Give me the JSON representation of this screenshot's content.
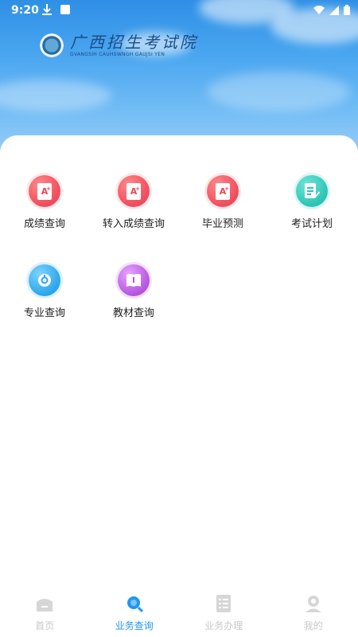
{
  "status_bar": {
    "time": "9:20"
  },
  "brand": {
    "name": "广西招生考试院",
    "subtitle": "GVANGSIH CAUHSWNGH GAUJSI YEN"
  },
  "menu": [
    {
      "label": "成绩查询",
      "icon": "score-report-icon",
      "color": "#ef4b5c"
    },
    {
      "label": "转入成绩查询",
      "icon": "transfer-score-icon",
      "color": "#ef4b5c"
    },
    {
      "label": "毕业预测",
      "icon": "graduation-forecast-icon",
      "color": "#ef4b5c"
    },
    {
      "label": "考试计划",
      "icon": "exam-plan-icon",
      "color": "#2bc4b4"
    },
    {
      "label": "专业查询",
      "icon": "major-query-icon",
      "color": "#2aa6ea"
    },
    {
      "label": "教材查询",
      "icon": "textbook-query-icon",
      "color": "#b455e0"
    }
  ],
  "tabbar": [
    {
      "label": "首页",
      "icon": "home-icon",
      "active": false
    },
    {
      "label": "业务查询",
      "icon": "search-icon",
      "active": true
    },
    {
      "label": "业务办理",
      "icon": "checklist-icon",
      "active": false
    },
    {
      "label": "我的",
      "icon": "profile-icon",
      "active": false
    }
  ],
  "colors": {
    "accent": "#2196f3",
    "inactive": "#c8c8c8"
  }
}
